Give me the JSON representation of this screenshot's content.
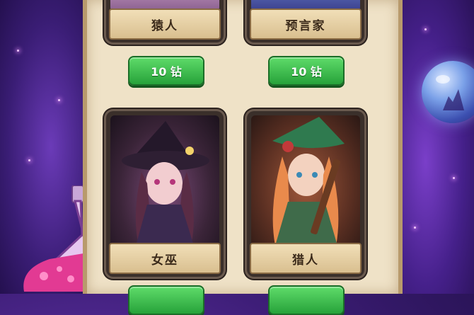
{
  "cards": [
    {
      "name": "猿人",
      "price": "10 钻"
    },
    {
      "name": "预言家",
      "price": "10 钻"
    },
    {
      "name": "女巫",
      "price": ""
    },
    {
      "name": "猎人",
      "price": ""
    }
  ],
  "colors": {
    "panel": "#efe2c7",
    "button": "#2fb144",
    "background": "#3b1c74"
  }
}
